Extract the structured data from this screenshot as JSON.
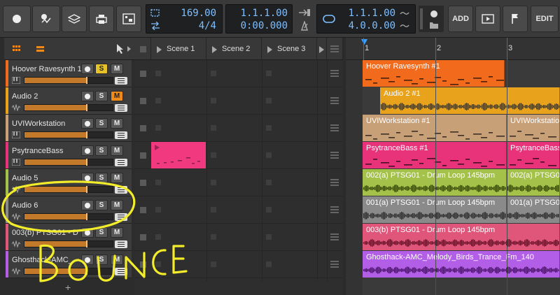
{
  "toolbar": {
    "tempo": "169.00",
    "time_signature": "4/4",
    "position_beats": "1.1.1.00",
    "position_time": "0:00.000",
    "loop_start": "1.1.1.00",
    "loop_length": "4.0.0.00",
    "add_label": "ADD",
    "edit_label": "EDIT"
  },
  "scenes": [
    {
      "label": "Scene 1"
    },
    {
      "label": "Scene 2"
    },
    {
      "label": "Scene 3"
    }
  ],
  "ruler": {
    "bars": [
      "1",
      "2",
      "3"
    ]
  },
  "tracks": [
    {
      "name": "Hoover Ravesynth 1",
      "color": "#f26b1d",
      "kind": "instrument",
      "solo_on": true,
      "mute_on": false,
      "level": 0.7
    },
    {
      "name": "Audio 2",
      "color": "#e8a21b",
      "kind": "audio",
      "solo_on": false,
      "mute_on": true,
      "level": 0.7
    },
    {
      "name": "UVIWorkstation",
      "color": "#c8a078",
      "kind": "instrument",
      "solo_on": false,
      "mute_on": false,
      "level": 0.7
    },
    {
      "name": "PsytranceBass",
      "color": "#e8337a",
      "kind": "instrument",
      "solo_on": false,
      "mute_on": false,
      "level": 0.7
    },
    {
      "name": "Audio 5",
      "color": "#a4c24a",
      "kind": "audio",
      "solo_on": false,
      "mute_on": false,
      "level": 0.7
    },
    {
      "name": "Audio 6",
      "color": "#8a8a8a",
      "kind": "audio",
      "solo_on": false,
      "mute_on": false,
      "level": 0.7
    },
    {
      "name": "003(b) PTSG01 - D",
      "color": "#e0567a",
      "kind": "audio",
      "solo_on": false,
      "mute_on": false,
      "level": 0.7
    },
    {
      "name": "Ghosthack-AMC_",
      "color": "#b25ee6",
      "kind": "audio",
      "solo_on": false,
      "mute_on": false,
      "level": 0.7
    }
  ],
  "arranger_clips": [
    {
      "lane": 0,
      "title": "Hoover Ravesynth #1",
      "color": "#f26b1d",
      "kind": "notes"
    },
    {
      "lane": 1,
      "title": "Audio 2 #1",
      "color": "#e8a21b",
      "kind": "wave"
    },
    {
      "lane": 2,
      "title": "UVIWorkstation #1",
      "color": "#c8a078",
      "kind": "notes"
    },
    {
      "lane": 2,
      "title": "UVIWorkstation",
      "color": "#c8a078",
      "kind": "notes"
    },
    {
      "lane": 3,
      "title": "PsytranceBass #1",
      "color": "#e8337a",
      "kind": "notes"
    },
    {
      "lane": 3,
      "title": "PsytranceBass #",
      "color": "#e8337a",
      "kind": "notes"
    },
    {
      "lane": 4,
      "title": "002(a) PTSG01 - Drum Loop 145bpm",
      "color": "#a4c24a",
      "kind": "wave"
    },
    {
      "lane": 4,
      "title": "002(a) PTSG0",
      "color": "#a4c24a",
      "kind": "wave"
    },
    {
      "lane": 5,
      "title": "001(a) PTSG01 - Drum Loop 145bpm",
      "color": "#8a8a8a",
      "kind": "wave"
    },
    {
      "lane": 5,
      "title": "001(a) PTSG0",
      "color": "#8a8a8a",
      "kind": "wave"
    },
    {
      "lane": 6,
      "title": "003(b) PTSG01 - Drum Loop 145bpm",
      "color": "#e0567a",
      "kind": "wave"
    },
    {
      "lane": 7,
      "title": "Ghosthack-AMC_Melody_Birds_Trance_Fm_140",
      "color": "#b25ee6",
      "kind": "wave"
    }
  ],
  "launcher_clip": {
    "track": 3,
    "scene": 0,
    "color": "#f0397f"
  },
  "annotation": {
    "text": "BOUNCE",
    "color": "#f2ec2a"
  }
}
